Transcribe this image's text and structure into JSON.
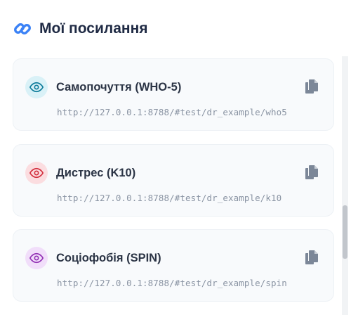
{
  "header": {
    "title": "Мої посилання",
    "icon": "link-icon",
    "icon_color": "#3b82f6"
  },
  "links": [
    {
      "title": "Самопочуття (WHO-5)",
      "url": "http://127.0.0.1:8788/#test/dr_example/who5",
      "icon": "eye-icon",
      "accent": "#0e7c9b",
      "accent_bg": "#d9f1f7"
    },
    {
      "title": "Дистрес (K10)",
      "url": "http://127.0.0.1:8788/#test/dr_example/k10",
      "icon": "eye-icon",
      "accent": "#d3303f",
      "accent_bg": "#fbdde0"
    },
    {
      "title": "Соціофобія (SPIN)",
      "url": "http://127.0.0.1:8788/#test/dr_example/spin",
      "icon": "eye-icon",
      "accent": "#9333b5",
      "accent_bg": "#f1defa"
    }
  ],
  "copy_icon": "copy-icon",
  "copy_icon_color": "#7c8798"
}
